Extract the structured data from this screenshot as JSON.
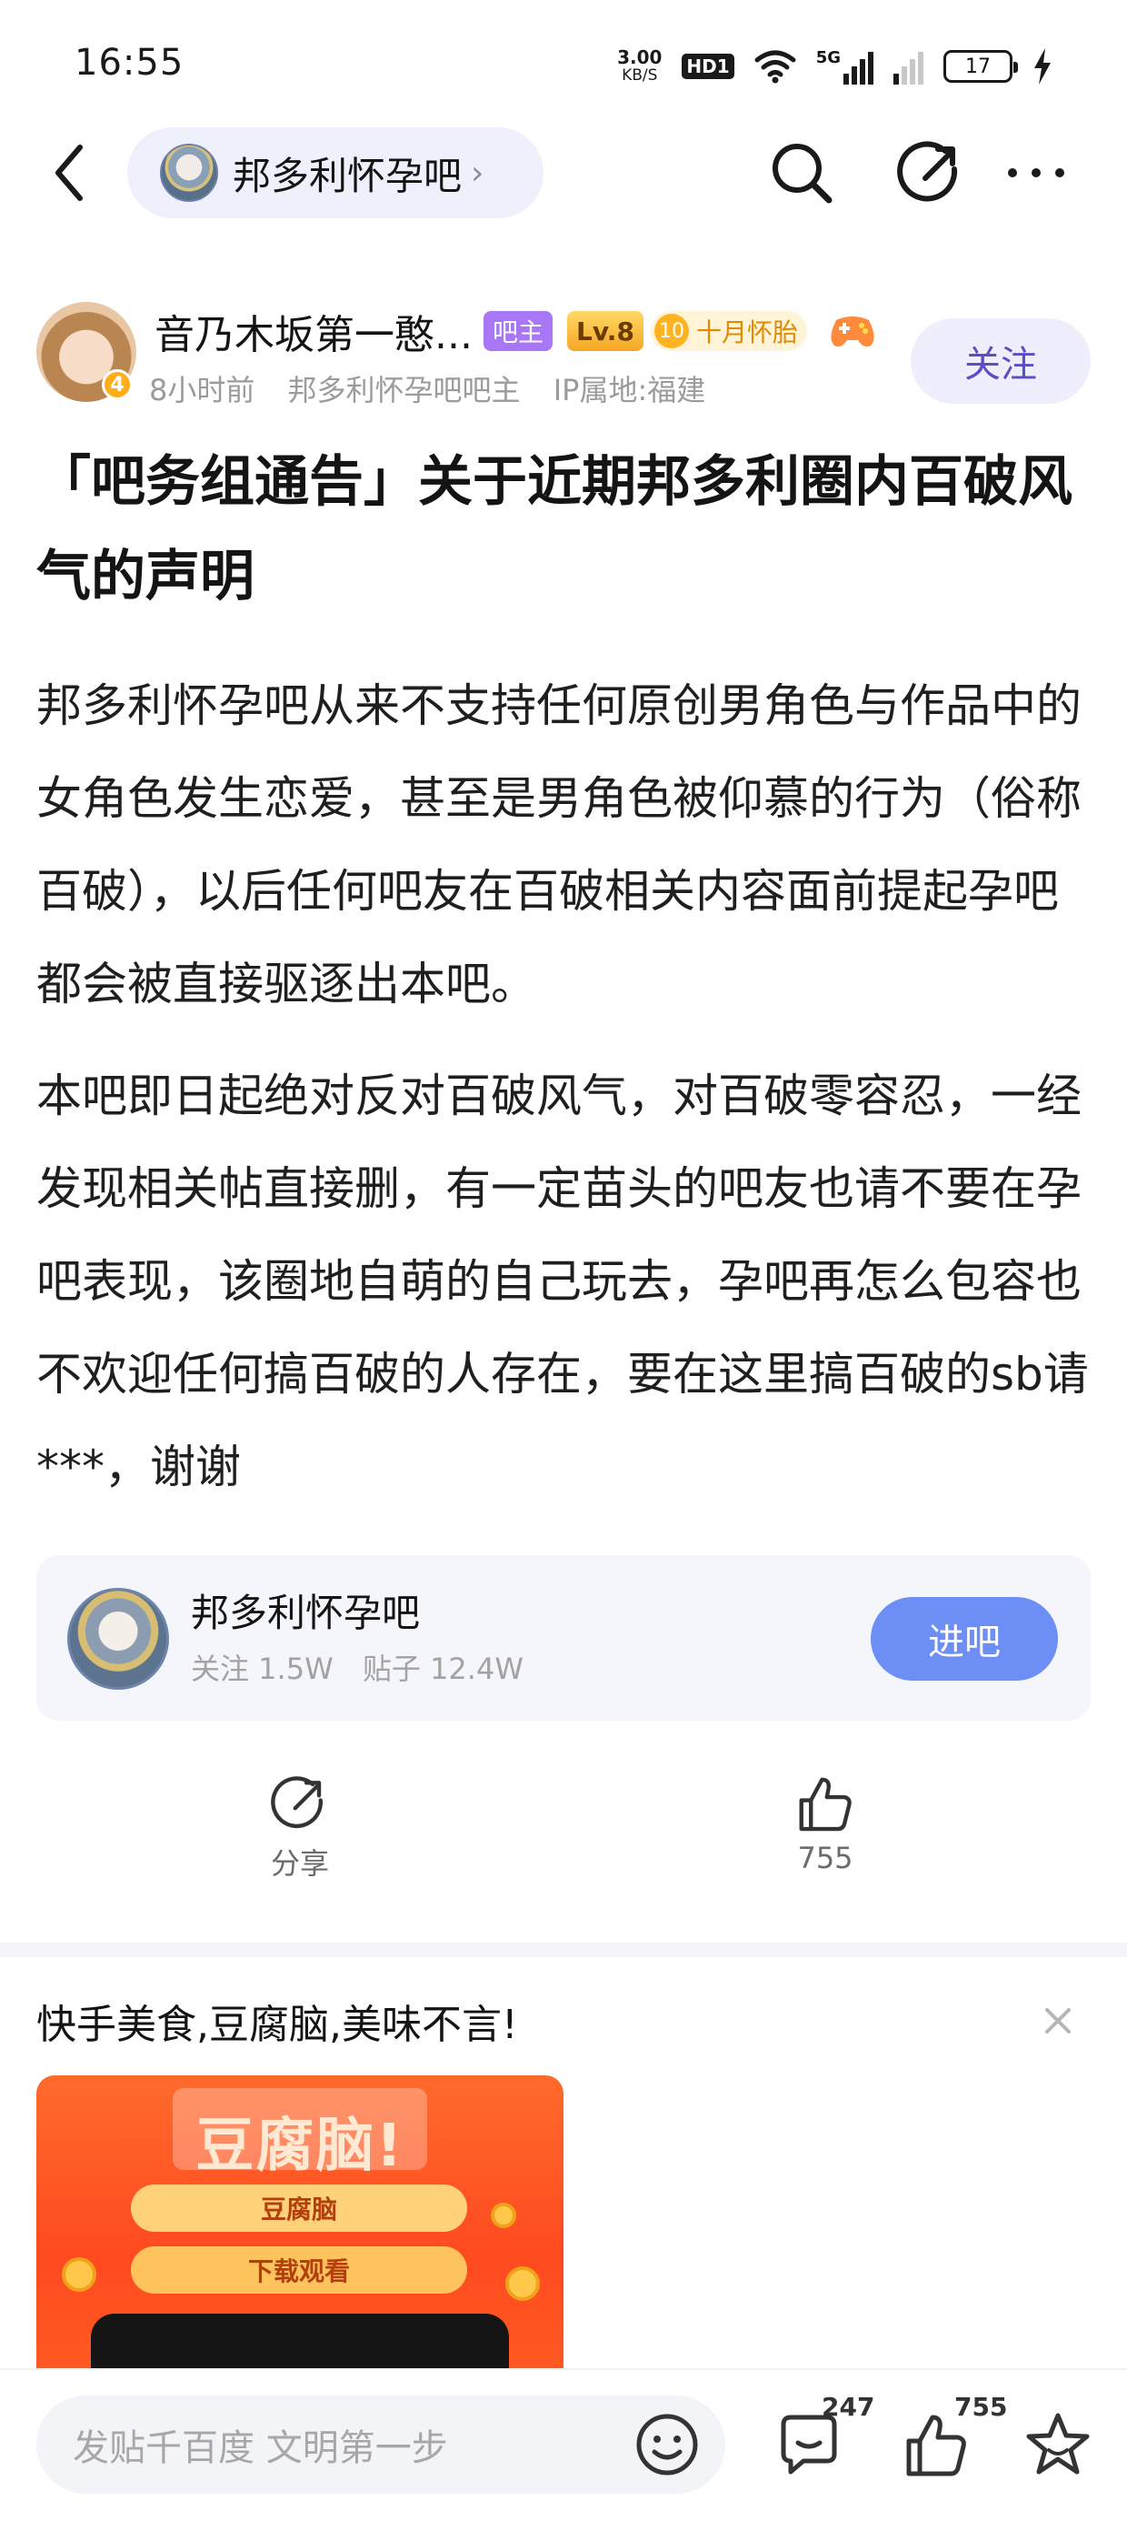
{
  "status_bar": {
    "time": "16:55",
    "net_speed_value": "3.00",
    "net_speed_unit": "KB/S",
    "hd_label": "HD1",
    "network": "5G",
    "battery": "17"
  },
  "nav": {
    "forum_name": "邦多利怀孕吧",
    "chevron": "›"
  },
  "author": {
    "name": "音乃木坂第一憨...",
    "avatar_badge": "4",
    "owner_tag": "吧主",
    "level_tag": "Lv.8",
    "month_badge_num": "10",
    "month_badge_text": "十月怀胎",
    "time_ago": "8小时前",
    "role": "邦多利怀孕吧吧主",
    "ip_location": "IP属地:福建",
    "follow_label": "关注"
  },
  "post": {
    "title": "「吧务组通告」关于近期邦多利圈内百破风气的声明",
    "paragraphs": [
      "邦多利怀孕吧从来不支持任何原创男角色与作品中的女角色发生恋爱，甚至是男角色被仰慕的行为（俗称百破），以后任何吧友在百破相关内容面前提起孕吧都会被直接驱逐出本吧。",
      "本吧即日起绝对反对百破风气，对百破零容忍，一经发现相关帖直接删，有一定苗头的吧友也请不要在孕吧表现，该圈地自萌的自己玩去，孕吧再怎么包容也不欢迎任何搞百破的人存在，要在这里搞百破的sb请***，谢谢"
    ]
  },
  "forum_card": {
    "name": "邦多利怀孕吧",
    "followers": "关注 1.5W",
    "posts": "贴子 12.4W",
    "enter_label": "进吧"
  },
  "actions": {
    "share_label": "分享",
    "like_count": "755"
  },
  "ad": {
    "title": "快手美食,豆腐脑,美味不言!",
    "big_text": "豆腐脑!",
    "bar1_text": "豆腐脑",
    "bar2_text": "下载观看"
  },
  "bottom_bar": {
    "reply_placeholder": "发贴千百度 文明第一步",
    "comment_count": "247",
    "like_count": "755"
  },
  "colors": {
    "accent_purple": "#5a4fc0",
    "enter_button": "#6d8ef5",
    "owner_tag": "#a777f5",
    "level_tag": "#f5a623"
  }
}
